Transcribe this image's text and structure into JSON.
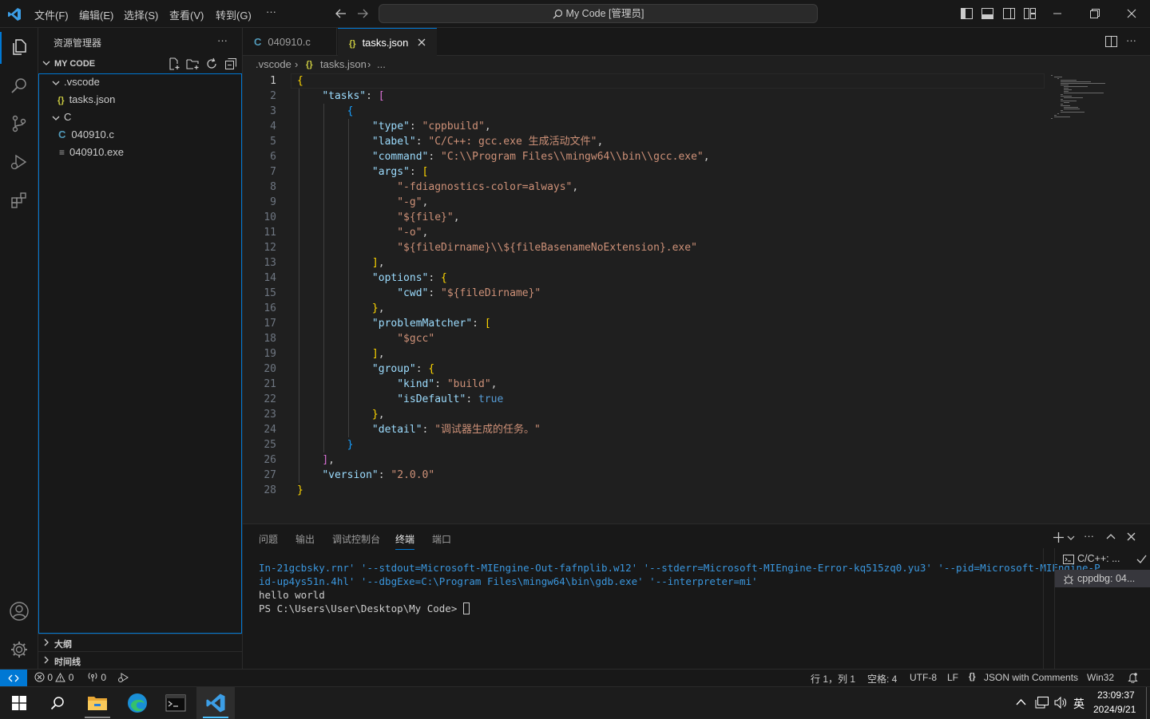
{
  "titlebar": {
    "menu": [
      "文件(F)",
      "编辑(E)",
      "选择(S)",
      "查看(V)",
      "转到(G)",
      "···"
    ],
    "search": "My Code [管理员]"
  },
  "sidebar": {
    "title": "资源管理器",
    "more": "···",
    "folder": "MY CODE",
    "items": [
      ".vscode",
      "tasks.json",
      "C",
      "040910.c",
      "040910.exe"
    ],
    "outline": "大纲",
    "timeline": "时间线"
  },
  "tabs": [
    {
      "icon": "C",
      "label": "040910.c"
    },
    {
      "icon": "{}",
      "label": "tasks.json"
    }
  ],
  "breadcrumb": [
    ".vscode",
    "tasks.json",
    "..."
  ],
  "editor": {
    "line_numbers": [
      "1",
      "2",
      "3",
      "4",
      "5",
      "6",
      "7",
      "8",
      "9",
      "10",
      "11",
      "12",
      "13",
      "14",
      "15",
      "16",
      "17",
      "18",
      "19",
      "20",
      "21",
      "22",
      "23",
      "24",
      "25",
      "26",
      "27",
      "28"
    ],
    "current_line": 1,
    "lines": [
      "{",
      "    \"tasks\": [",
      "        {",
      "            \"type\": \"cppbuild\",",
      "            \"label\": \"C/C++: gcc.exe 生成活动文件\",",
      "            \"command\": \"C:\\\\Program Files\\\\mingw64\\\\bin\\\\gcc.exe\",",
      "            \"args\": [",
      "                \"-fdiagnostics-color=always\",",
      "                \"-g\",",
      "                \"${file}\",",
      "                \"-o\",",
      "                \"${fileDirname}\\\\${fileBasenameNoExtension}.exe\"",
      "            ],",
      "            \"options\": {",
      "                \"cwd\": \"${fileDirname}\"",
      "            },",
      "            \"problemMatcher\": [",
      "                \"$gcc\"",
      "            ],",
      "            \"group\": {",
      "                \"kind\": \"build\",",
      "                \"isDefault\": true",
      "            },",
      "            \"detail\": \"调试器生成的任务。\"",
      "        }",
      "    ],",
      "    \"version\": \"2.0.0\"",
      "}"
    ]
  },
  "panel": {
    "tabs": [
      "问题",
      "输出",
      "调试控制台",
      "终端",
      "端口"
    ],
    "active_tab": "终端",
    "terminal_lines": [
      "In-21gcbsky.rnr' '--stdout=Microsoft-MIEngine-Out-fafnplib.w12' '--stderr=Microsoft-MIEngine-Error-kq515zq0.yu3' '--pid=Microsoft-MIEngine-P",
      "id-up4ys51n.4hl' '--dbgExe=C:\\Program Files\\mingw64\\bin\\gdb.exe' '--interpreter=mi'",
      "hello world",
      "PS C:\\Users\\User\\Desktop\\My Code> "
    ],
    "terminals": [
      "C/C++: ...",
      "cppdbg: 04..."
    ]
  },
  "status": {
    "errors": "0",
    "warnings": "0",
    "ports": "0",
    "position": "行 1，列 1",
    "spaces": "空格: 4",
    "encoding": "UTF-8",
    "eol": "LF",
    "language": "JSON with Comments",
    "platform": "Win32"
  },
  "taskbar": {
    "ime": "英",
    "time": "23:09:37",
    "date": "2024/9/21"
  },
  "colors": {
    "accent": "#0078d4",
    "key": "#9cdcfe",
    "string": "#ce9178",
    "bracket_gold": "#ffd700",
    "bracket_purple": "#da70d6",
    "bracket_blue": "#179fff",
    "keyword": "#569cd6"
  }
}
